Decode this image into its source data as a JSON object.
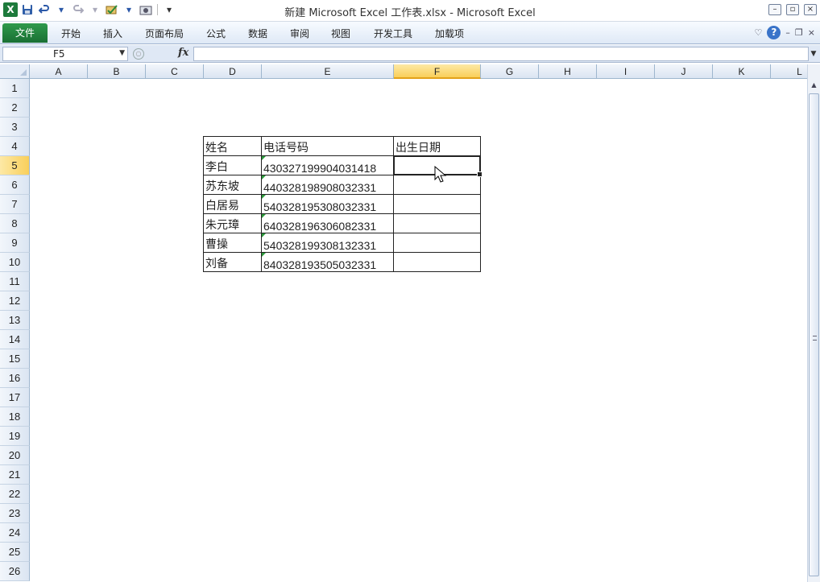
{
  "window": {
    "title": "新建 Microsoft Excel 工作表.xlsx - Microsoft Excel",
    "app_icon": "X",
    "controls": [
      "minimize-icon",
      "restore-icon",
      "close-icon"
    ]
  },
  "quick_access": {
    "icons": [
      "save-icon",
      "undo-icon",
      "redo-icon",
      "spellcheck-icon",
      "camera-icon",
      "customize-icon"
    ]
  },
  "ribbon": {
    "file_tab": "文件",
    "tabs": [
      "开始",
      "插入",
      "页面布局",
      "公式",
      "数据",
      "审阅",
      "视图",
      "开发工具",
      "加载项"
    ],
    "help_label": "?"
  },
  "formula_bar": {
    "name_box": "F5",
    "fx_label": "fx",
    "formula_value": ""
  },
  "columns": [
    "A",
    "B",
    "C",
    "D",
    "E",
    "F",
    "G",
    "H",
    "I",
    "J",
    "K",
    "L"
  ],
  "selected_column": "F",
  "rows": [
    "1",
    "2",
    "3",
    "4",
    "5",
    "6",
    "7",
    "8",
    "9",
    "10",
    "11",
    "12",
    "13",
    "14",
    "15",
    "16",
    "17",
    "18",
    "19",
    "20",
    "21",
    "22",
    "23",
    "24",
    "25",
    "26"
  ],
  "selected_row": "5",
  "table": {
    "headers": [
      "姓名",
      "电话号码",
      "出生日期"
    ],
    "rows": [
      {
        "name": "李白",
        "phone": "430327199904031418",
        "date": ""
      },
      {
        "name": "苏东坡",
        "phone": "440328198908032331",
        "date": ""
      },
      {
        "name": "白居易",
        "phone": "540328195308032331",
        "date": ""
      },
      {
        "name": "朱元璋",
        "phone": "640328196306082331",
        "date": ""
      },
      {
        "name": "曹操",
        "phone": "540328199308132331",
        "date": ""
      },
      {
        "name": "刘备",
        "phone": "840328193505032331",
        "date": ""
      }
    ]
  },
  "colors": {
    "file_tab": "#1a7034",
    "selection_header": "#f9cf5a",
    "text_indicator": "#2a9a3a"
  }
}
